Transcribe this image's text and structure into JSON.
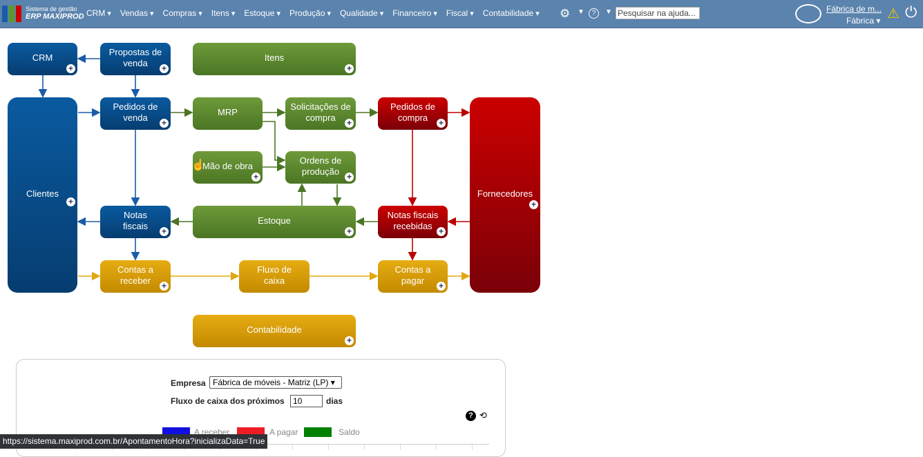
{
  "header": {
    "brand_top": "Sistema de gestão",
    "brand_bottom": "ERP MAXIPROD",
    "menu": [
      "CRM",
      "Vendas",
      "Compras",
      "Itens",
      "Estoque",
      "Produção",
      "Qualidade",
      "Financeiro",
      "Fiscal",
      "Contabilidade"
    ],
    "search_placeholder": "Pesquisar na ajuda...",
    "company_link": "Fábrica de m...",
    "company_select": "Fábrica"
  },
  "flow": {
    "crm": "CRM",
    "propostas": "Propostas de venda",
    "itens": "Itens",
    "clientes": "Clientes",
    "pedidos_venda": "Pedidos de venda",
    "mrp": "MRP",
    "solicitacoes": "Solicitações de compra",
    "pedidos_compra": "Pedidos de compra",
    "fornecedores": "Fornecedores",
    "mao_obra": "Mão de obra",
    "ordens": "Ordens de produção",
    "notas": "Notas fiscais",
    "estoque": "Estoque",
    "notas_recebidas": "Notas fiscais recebidas",
    "contas_receber": "Contas a receber",
    "fluxo": "Fluxo de caixa",
    "contas_pagar": "Contas a pagar",
    "contabilidade": "Contabilidade",
    "plus": "+"
  },
  "cashflow": {
    "empresa_label": "Empresa",
    "empresa_value": "Fábrica de móveis - Matriz (LP) ▾",
    "fluxo_label": "Fluxo de caixa dos próximos",
    "days": "10",
    "days_unit": "dias",
    "legend": [
      {
        "label": "A receber",
        "color": "#1010e0"
      },
      {
        "label": "A pagar",
        "color": "#ee1c25"
      },
      {
        "label": "Saldo",
        "color": "#008000"
      }
    ]
  },
  "status_url": "https://sistema.maxiprod.com.br/ApontamentoHora?inicializaData=True"
}
